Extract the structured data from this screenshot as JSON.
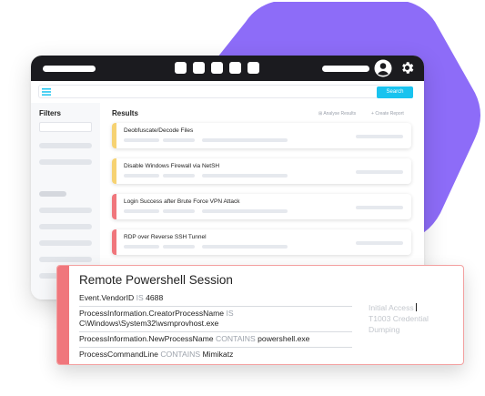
{
  "colors": {
    "accent_purple": "#8d6cf8",
    "search_button": "#19c3ef",
    "severity_medium": "#f6d272",
    "severity_high": "#f0767c",
    "titlebar": "#1b1b1f"
  },
  "titlebar": {
    "icons": [
      "user-avatar-icon",
      "gear-icon"
    ]
  },
  "toolbar": {
    "menu_icon": "hamburger-menu-icon",
    "search_label": "Search"
  },
  "sidebar": {
    "title": "Filters"
  },
  "results": {
    "title": "Results",
    "analyse_label": "Analyse Results",
    "create_label": "Create Report",
    "items": [
      {
        "title": "Deobfuscate/Decode Files",
        "severity": "medium"
      },
      {
        "title": "Disable Windows Firewall via NetSH",
        "severity": "medium"
      },
      {
        "title": "Login Success after Brute Force VPN Attack",
        "severity": "high"
      },
      {
        "title": "RDP over Reverse SSH Tunnel",
        "severity": "high"
      }
    ]
  },
  "detail": {
    "title": "Remote Powershell Session",
    "conditions": [
      {
        "field": "Event.VendorID",
        "op": "IS",
        "value": "4688"
      },
      {
        "field": "ProcessInformation.CreatorProcessName",
        "op": "IS",
        "value": "C\\Windows\\System32\\wsmprovhost.exe"
      },
      {
        "field": "ProcessInformation.NewProcessName",
        "op": "CONTAINS",
        "value": "powershell.exe"
      },
      {
        "field": "ProcessCommandLine",
        "op": "CONTAINS",
        "value": "Mimikatz"
      }
    ],
    "tags": [
      "Initial Access",
      "T1003 Credential",
      "Dumping"
    ]
  }
}
